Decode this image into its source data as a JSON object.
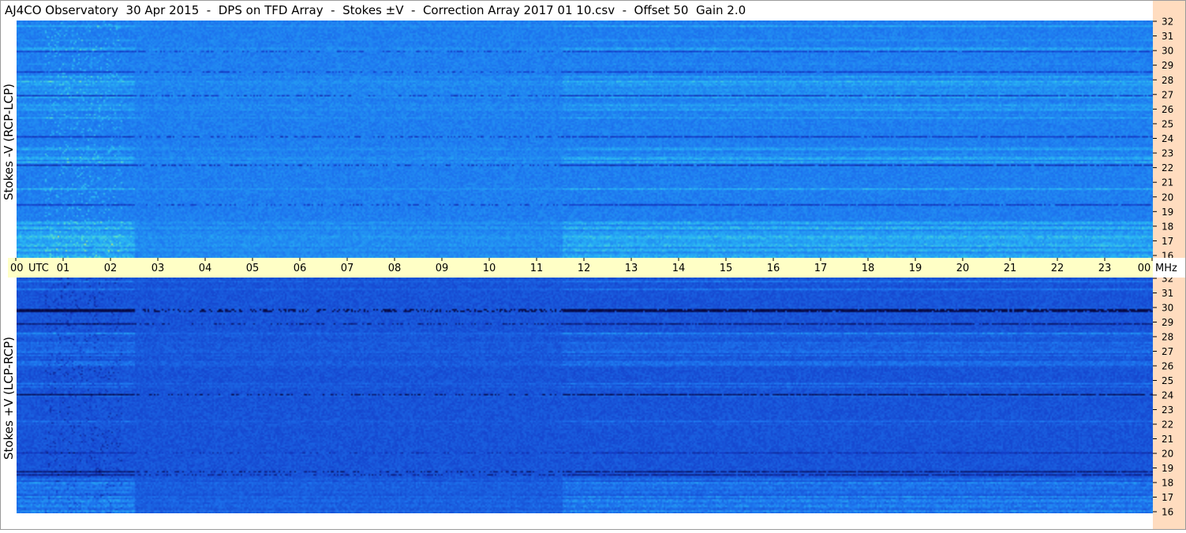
{
  "header": {
    "title": "AJ4CO Observatory  30 Apr 2015  -  DPS on TFD Array  -  Stokes ±V  -  Correction Array 2017 01 10.csv  -  Offset 50  Gain 2.0"
  },
  "panels": {
    "top_label": "Stokes -V (RCP-LCP)",
    "bottom_label": "Stokes +V (LCP-RCP)"
  },
  "colors": {
    "top_base": "#1f80ee",
    "bottom_base": "#1a55e0",
    "axis_col_bg": "#ffdcbf",
    "time_axis_bg": "#ffffc6"
  },
  "chart_data": {
    "type": "heatmap",
    "x_axis": {
      "label": "UTC",
      "ticks": [
        "00",
        "01",
        "02",
        "03",
        "04",
        "05",
        "06",
        "07",
        "08",
        "09",
        "10",
        "11",
        "12",
        "13",
        "14",
        "15",
        "16",
        "17",
        "18",
        "19",
        "20",
        "21",
        "22",
        "23",
        "00"
      ],
      "range": [
        0,
        24
      ]
    },
    "y_axis": {
      "unit": "MHz",
      "ticks": [
        16,
        17,
        18,
        19,
        20,
        21,
        22,
        23,
        24,
        25,
        26,
        27,
        28,
        29,
        30,
        31,
        32
      ],
      "range": [
        16,
        32
      ]
    },
    "panels": [
      {
        "name": "Stokes -V (RCP-LCP)"
      },
      {
        "name": "Stokes +V (LCP-RCP)"
      }
    ]
  }
}
